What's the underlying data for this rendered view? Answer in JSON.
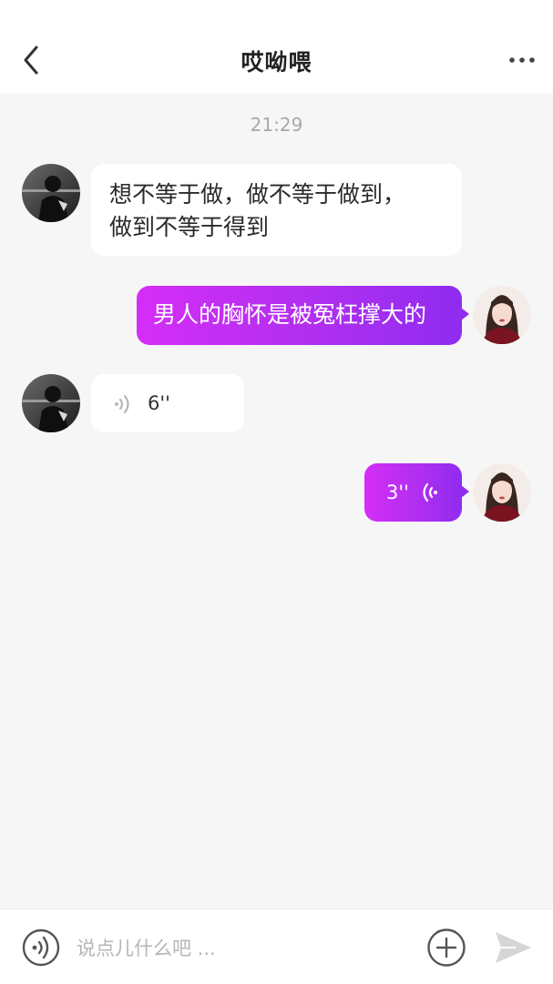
{
  "header": {
    "title": "哎呦喂",
    "back_icon": "chevron-left-icon",
    "more_icon": "more-dots-icon"
  },
  "chat": {
    "timestamp": "21:29",
    "messages": [
      {
        "sender": "other",
        "type": "text",
        "text_line1": "想不等于做，做不等于做到，",
        "text_line2": "做到不等于得到"
      },
      {
        "sender": "me",
        "type": "text",
        "text": "男人的胸怀是被冤枉撑大的"
      },
      {
        "sender": "other",
        "type": "voice",
        "duration": "6''"
      },
      {
        "sender": "me",
        "type": "voice",
        "duration": "3''"
      }
    ]
  },
  "input_bar": {
    "placeholder": "说点儿什么吧 ...",
    "voice_icon": "voice-toggle-icon",
    "plus_icon": "plus-circle-icon",
    "send_icon": "send-icon"
  },
  "colors": {
    "accent_start": "#d42ef7",
    "accent_end": "#8f2cf0",
    "background": "#f6f6f6"
  }
}
